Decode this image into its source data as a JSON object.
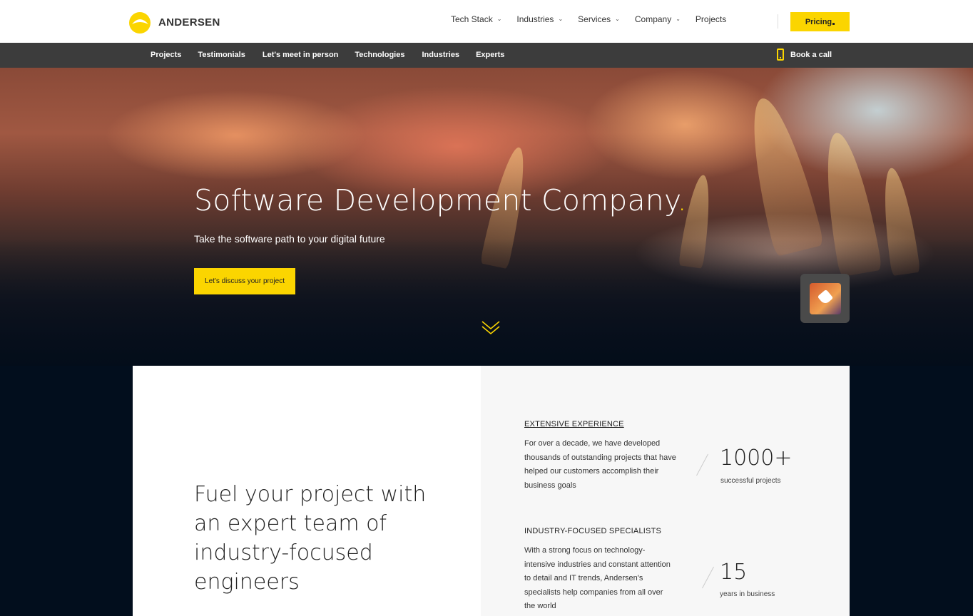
{
  "header": {
    "logo_text": "ANDERSEN",
    "nav": [
      {
        "label": "Tech Stack",
        "dropdown": true
      },
      {
        "label": "Industries",
        "dropdown": true
      },
      {
        "label": "Services",
        "dropdown": true
      },
      {
        "label": "Company",
        "dropdown": true
      },
      {
        "label": "Projects",
        "dropdown": false
      }
    ],
    "pricing_label": "Pricing"
  },
  "subnav": {
    "links": [
      "Projects",
      "Testimonials",
      "Let's meet in person",
      "Technologies",
      "Industries",
      "Experts"
    ],
    "book_call": "Book a call"
  },
  "hero": {
    "title": "Software Development Company",
    "title_period": ".",
    "subtitle": "Take the software path to your digital future",
    "cta": "Let's discuss your project"
  },
  "content": {
    "headline": "Fuel your project with an expert team of industry-focused engineers",
    "features": [
      {
        "title": "EXTENSIVE EXPERIENCE",
        "text": "For over a decade, we have developed thousands of outstanding projects that have helped our customers accomplish their business goals",
        "stat_value": "1000+",
        "stat_label": "successful projects"
      },
      {
        "title": "INDUSTRY-FOCUSED SPECIALISTS",
        "text": "With a strong focus on technology-intensive industries and constant attention to detail and IT trends, Andersen's specialists help companies from all over the world",
        "stat_value": "15",
        "stat_label": "years in business"
      }
    ]
  },
  "colors": {
    "accent": "#fbd500",
    "subnav_bg": "#3c3c3c",
    "page_dark": "#020e1d"
  },
  "icons": [
    "andersen-logo-icon",
    "chevron-down-icon",
    "phone-icon",
    "scroll-down-chevron-icon",
    "chat-widget-icon"
  ]
}
